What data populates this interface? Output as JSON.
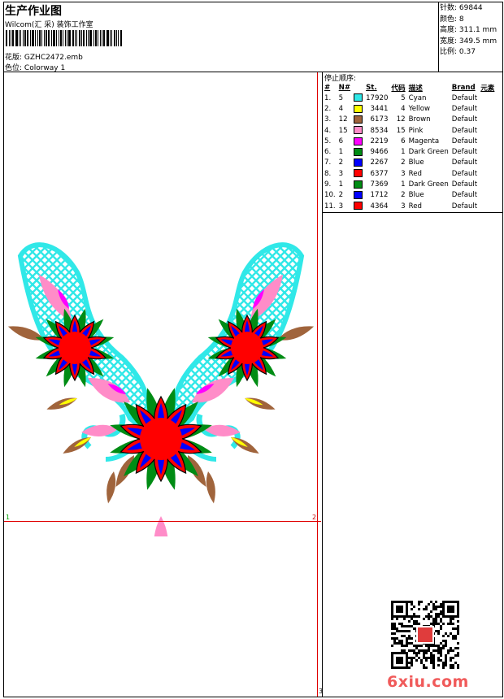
{
  "header": {
    "title": "生产作业图",
    "company": "Wilcom(汇 采) 装饰工作室",
    "design_label": "花版:",
    "design_value": "GZHC2472.emb",
    "colorway_label": "色位:",
    "colorway_value": "Colorway 1"
  },
  "stats": [
    {
      "label": "针数:",
      "value": "69844"
    },
    {
      "label": "颜色:",
      "value": "8"
    },
    {
      "label": "高度:",
      "value": "311.1 mm"
    },
    {
      "label": "宽度:",
      "value": "349.5 mm"
    },
    {
      "label": "比例:",
      "value": "0.37"
    }
  ],
  "sequence": {
    "title": "停止顺序:",
    "headers": [
      "#",
      "N#",
      "St.",
      "代码",
      "描述",
      "Brand",
      "元素"
    ],
    "rows": [
      {
        "idx": "1.",
        "n": "5",
        "color": "#30e8e8",
        "st": "17920",
        "code": "5",
        "desc": "Cyan",
        "brand": "Default"
      },
      {
        "idx": "2.",
        "n": "4",
        "color": "#ffff00",
        "st": "3441",
        "code": "4",
        "desc": "Yellow",
        "brand": "Default"
      },
      {
        "idx": "3.",
        "n": "12",
        "color": "#a0643c",
        "st": "6173",
        "code": "12",
        "desc": "Brown",
        "brand": "Default"
      },
      {
        "idx": "4.",
        "n": "15",
        "color": "#ff8cc8",
        "st": "8534",
        "code": "15",
        "desc": "Pink",
        "brand": "Default"
      },
      {
        "idx": "5.",
        "n": "6",
        "color": "#ff00ff",
        "st": "2219",
        "code": "6",
        "desc": "Magenta",
        "brand": "Default"
      },
      {
        "idx": "6.",
        "n": "1",
        "color": "#008c14",
        "st": "9466",
        "code": "1",
        "desc": "Dark Green",
        "brand": "Default"
      },
      {
        "idx": "7.",
        "n": "2",
        "color": "#0000ff",
        "st": "2267",
        "code": "2",
        "desc": "Blue",
        "brand": "Default"
      },
      {
        "idx": "8.",
        "n": "3",
        "color": "#ff0000",
        "st": "6377",
        "code": "3",
        "desc": "Red",
        "brand": "Default"
      },
      {
        "idx": "9.",
        "n": "1",
        "color": "#008c14",
        "st": "7369",
        "code": "1",
        "desc": "Dark Green",
        "brand": "Default"
      },
      {
        "idx": "10.",
        "n": "2",
        "color": "#0000ff",
        "st": "1712",
        "code": "2",
        "desc": "Blue",
        "brand": "Default"
      },
      {
        "idx": "11.",
        "n": "3",
        "color": "#ff0000",
        "st": "4364",
        "code": "3",
        "desc": "Red",
        "brand": "Default"
      }
    ]
  },
  "markers": {
    "left": "1",
    "right": "2",
    "bottom": "3"
  },
  "watermark": "6xiu.com",
  "colors": {
    "cyan": "#30e8e8",
    "pink": "#ff8cc8",
    "magenta": "#ff00ff",
    "green": "#008c14",
    "blue": "#0000ff",
    "red": "#ff0000",
    "brown": "#a0643c",
    "yellow": "#ffff00",
    "guide": "#e00000"
  }
}
